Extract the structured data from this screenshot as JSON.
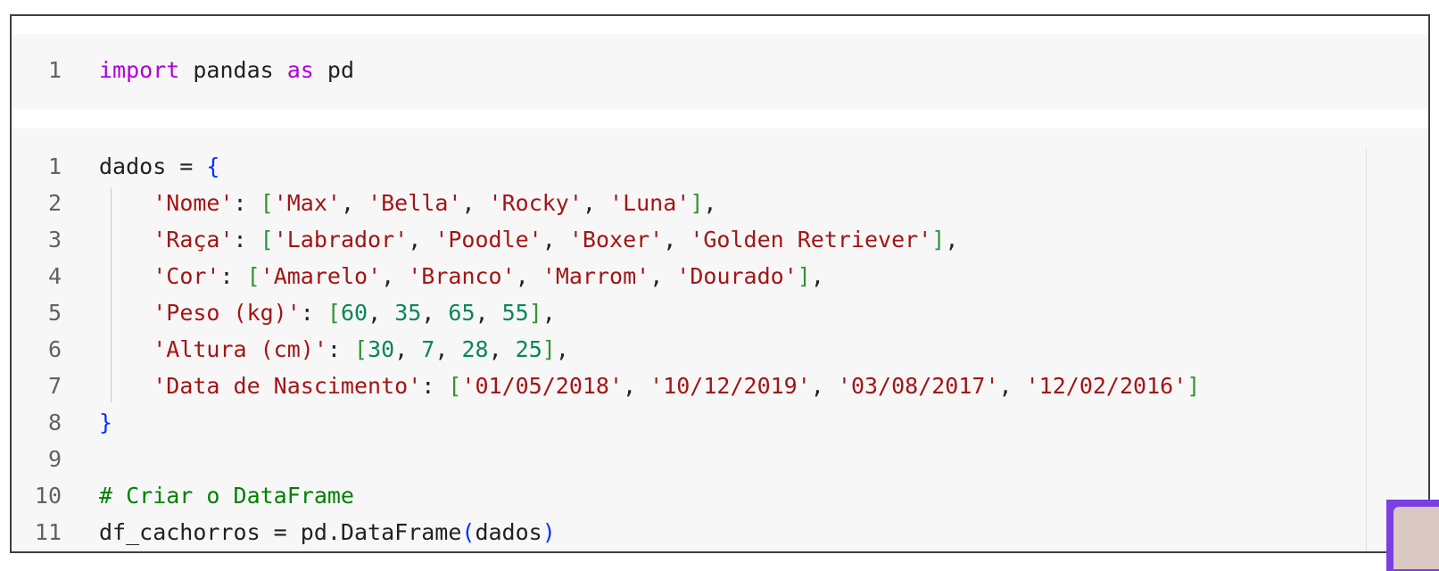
{
  "cells": [
    {
      "lines": [
        {
          "n": "1",
          "tokens": [
            {
              "t": "import",
              "c": "kw"
            },
            {
              "t": " pandas ",
              "c": ""
            },
            {
              "t": "as",
              "c": "kw"
            },
            {
              "t": " pd",
              "c": ""
            }
          ]
        }
      ]
    },
    {
      "lines": [
        {
          "n": "1",
          "tokens": [
            {
              "t": "dados = ",
              "c": ""
            },
            {
              "t": "{",
              "c": "br1"
            }
          ]
        },
        {
          "n": "2",
          "tokens": [
            {
              "t": "    ",
              "c": ""
            },
            {
              "t": "'Nome'",
              "c": "str"
            },
            {
              "t": ": ",
              "c": ""
            },
            {
              "t": "[",
              "c": "br2"
            },
            {
              "t": "'Max'",
              "c": "str"
            },
            {
              "t": ", ",
              "c": ""
            },
            {
              "t": "'Bella'",
              "c": "str"
            },
            {
              "t": ", ",
              "c": ""
            },
            {
              "t": "'Rocky'",
              "c": "str"
            },
            {
              "t": ", ",
              "c": ""
            },
            {
              "t": "'Luna'",
              "c": "str"
            },
            {
              "t": "]",
              "c": "br2"
            },
            {
              "t": ",",
              "c": ""
            }
          ]
        },
        {
          "n": "3",
          "tokens": [
            {
              "t": "    ",
              "c": ""
            },
            {
              "t": "'Raça'",
              "c": "str"
            },
            {
              "t": ": ",
              "c": ""
            },
            {
              "t": "[",
              "c": "br2"
            },
            {
              "t": "'Labrador'",
              "c": "str"
            },
            {
              "t": ", ",
              "c": ""
            },
            {
              "t": "'Poodle'",
              "c": "str"
            },
            {
              "t": ", ",
              "c": ""
            },
            {
              "t": "'Boxer'",
              "c": "str"
            },
            {
              "t": ", ",
              "c": ""
            },
            {
              "t": "'Golden Retriever'",
              "c": "str"
            },
            {
              "t": "]",
              "c": "br2"
            },
            {
              "t": ",",
              "c": ""
            }
          ]
        },
        {
          "n": "4",
          "tokens": [
            {
              "t": "    ",
              "c": ""
            },
            {
              "t": "'Cor'",
              "c": "str"
            },
            {
              "t": ": ",
              "c": ""
            },
            {
              "t": "[",
              "c": "br2"
            },
            {
              "t": "'Amarelo'",
              "c": "str"
            },
            {
              "t": ", ",
              "c": ""
            },
            {
              "t": "'Branco'",
              "c": "str"
            },
            {
              "t": ", ",
              "c": ""
            },
            {
              "t": "'Marrom'",
              "c": "str"
            },
            {
              "t": ", ",
              "c": ""
            },
            {
              "t": "'Dourado'",
              "c": "str"
            },
            {
              "t": "]",
              "c": "br2"
            },
            {
              "t": ",",
              "c": ""
            }
          ]
        },
        {
          "n": "5",
          "tokens": [
            {
              "t": "    ",
              "c": ""
            },
            {
              "t": "'Peso (kg)'",
              "c": "str"
            },
            {
              "t": ": ",
              "c": ""
            },
            {
              "t": "[",
              "c": "br2"
            },
            {
              "t": "60",
              "c": "num"
            },
            {
              "t": ", ",
              "c": ""
            },
            {
              "t": "35",
              "c": "num"
            },
            {
              "t": ", ",
              "c": ""
            },
            {
              "t": "65",
              "c": "num"
            },
            {
              "t": ", ",
              "c": ""
            },
            {
              "t": "55",
              "c": "num"
            },
            {
              "t": "]",
              "c": "br2"
            },
            {
              "t": ",",
              "c": ""
            }
          ]
        },
        {
          "n": "6",
          "tokens": [
            {
              "t": "    ",
              "c": ""
            },
            {
              "t": "'Altura (cm)'",
              "c": "str"
            },
            {
              "t": ": ",
              "c": ""
            },
            {
              "t": "[",
              "c": "br2"
            },
            {
              "t": "30",
              "c": "num"
            },
            {
              "t": ", ",
              "c": ""
            },
            {
              "t": "7",
              "c": "num"
            },
            {
              "t": ", ",
              "c": ""
            },
            {
              "t": "28",
              "c": "num"
            },
            {
              "t": ", ",
              "c": ""
            },
            {
              "t": "25",
              "c": "num"
            },
            {
              "t": "]",
              "c": "br2"
            },
            {
              "t": ",",
              "c": ""
            }
          ]
        },
        {
          "n": "7",
          "tokens": [
            {
              "t": "    ",
              "c": ""
            },
            {
              "t": "'Data de Nascimento'",
              "c": "str"
            },
            {
              "t": ": ",
              "c": ""
            },
            {
              "t": "[",
              "c": "br2"
            },
            {
              "t": "'01/05/2018'",
              "c": "str"
            },
            {
              "t": ", ",
              "c": ""
            },
            {
              "t": "'10/12/2019'",
              "c": "str"
            },
            {
              "t": ", ",
              "c": ""
            },
            {
              "t": "'03/08/2017'",
              "c": "str"
            },
            {
              "t": ", ",
              "c": ""
            },
            {
              "t": "'12/02/2016'",
              "c": "str"
            },
            {
              "t": "]",
              "c": "br2"
            }
          ]
        },
        {
          "n": "8",
          "tokens": [
            {
              "t": "}",
              "c": "br1"
            }
          ]
        },
        {
          "n": "9",
          "tokens": []
        },
        {
          "n": "10",
          "tokens": [
            {
              "t": "# Criar o DataFrame",
              "c": "com"
            }
          ]
        },
        {
          "n": "11",
          "tokens": [
            {
              "t": "df_cachorros = pd.DataFrame",
              "c": ""
            },
            {
              "t": "(",
              "c": "br1"
            },
            {
              "t": "dados",
              "c": ""
            },
            {
              "t": ")",
              "c": "br1"
            }
          ]
        }
      ]
    }
  ],
  "colors": {
    "keyword": "#af00db",
    "string": "#a31515",
    "number": "#098658",
    "comment": "#008000",
    "bracket_level1": "#0431fa",
    "bracket_level2": "#319331"
  }
}
